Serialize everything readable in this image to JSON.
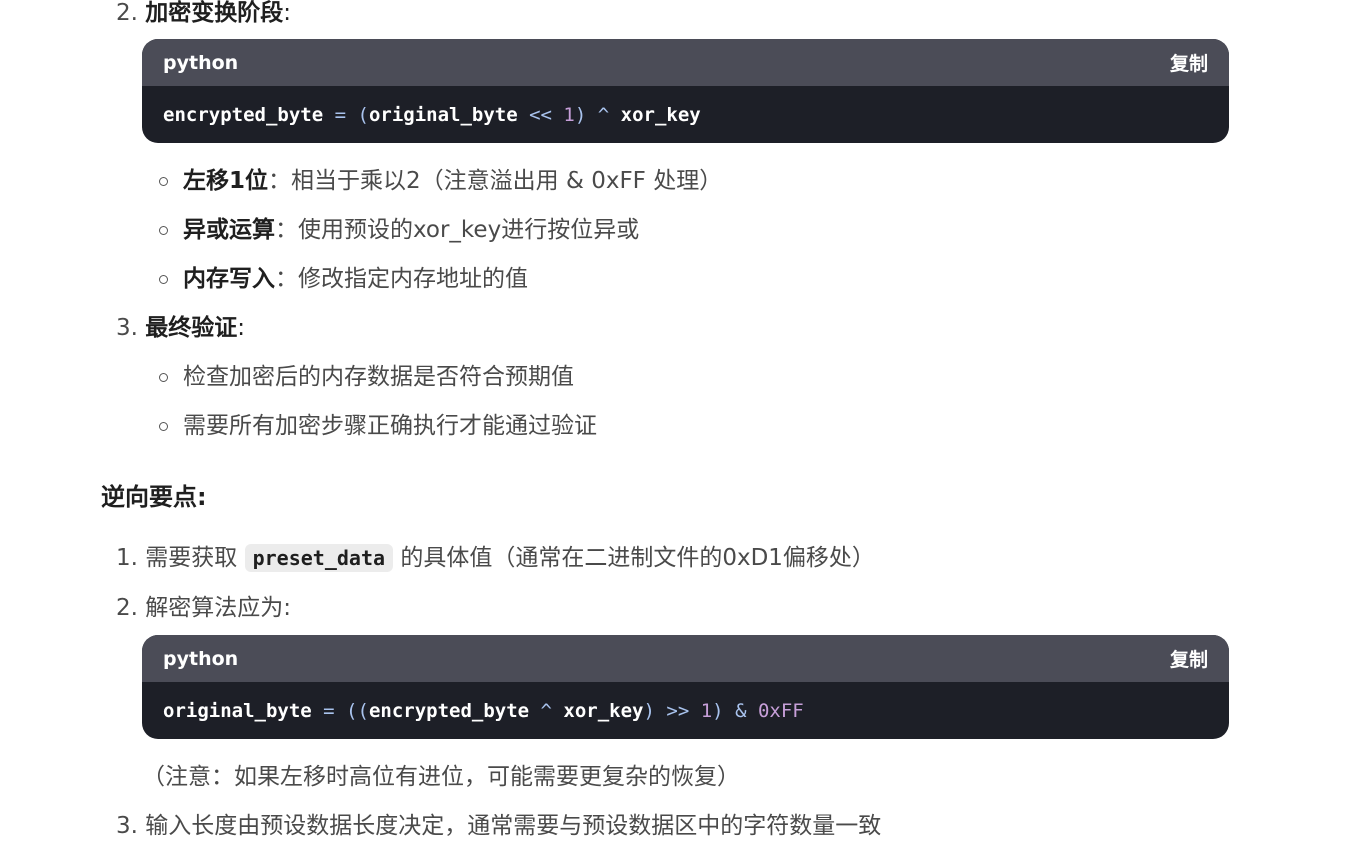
{
  "step2": {
    "num": "2.",
    "title": "加密变换阶段",
    "colon": ":"
  },
  "code1": {
    "lang": "python",
    "copy": "复制",
    "tokens": {
      "t1": "encrypted_byte",
      "t2": " = ",
      "t3": "(",
      "t4": "original_byte",
      "t5": " << ",
      "t6": "1",
      "t7": ")",
      "t8": " ^ ",
      "t9": "xor_key"
    }
  },
  "bullets1": [
    {
      "strong": "左移1位",
      "text": "：相当于乘以2（注意溢出用 & 0xFF 处理）"
    },
    {
      "strong": "异或运算",
      "text": "：使用预设的xor_key进行按位异或"
    },
    {
      "strong": "内存写入",
      "text": "：修改指定内存地址的值"
    }
  ],
  "step3": {
    "num": "3.",
    "title": "最终验证",
    "colon": ":"
  },
  "bullets2": [
    {
      "text": "检查加密后的内存数据是否符合预期值"
    },
    {
      "text": "需要所有加密步骤正确执行才能通过验证"
    }
  ],
  "heading": "逆向要点:",
  "points": {
    "p1": {
      "num": "1.",
      "pre": "需要获取",
      "code": "preset_data",
      "post": "的具体值（通常在二进制文件的0xD1偏移处）"
    },
    "p2": {
      "num": "2.",
      "text": "解密算法应为:"
    },
    "note": "（注意：如果左移时高位有进位，可能需要更复杂的恢复）",
    "p3": {
      "num": "3.",
      "text": "输入长度由预设数据长度决定，通常需要与预设数据区中的字符数量一致"
    }
  },
  "code2": {
    "lang": "python",
    "copy": "复制",
    "tokens": {
      "t1": "original_byte",
      "t2": " = ",
      "t3": "((",
      "t4": "encrypted_byte",
      "t5": " ^ ",
      "t6": "xor_key",
      "t7": ")",
      "t8": " >> ",
      "t9": "1",
      "t10": ")",
      "t11": " & ",
      "t12": "0xFF"
    }
  }
}
